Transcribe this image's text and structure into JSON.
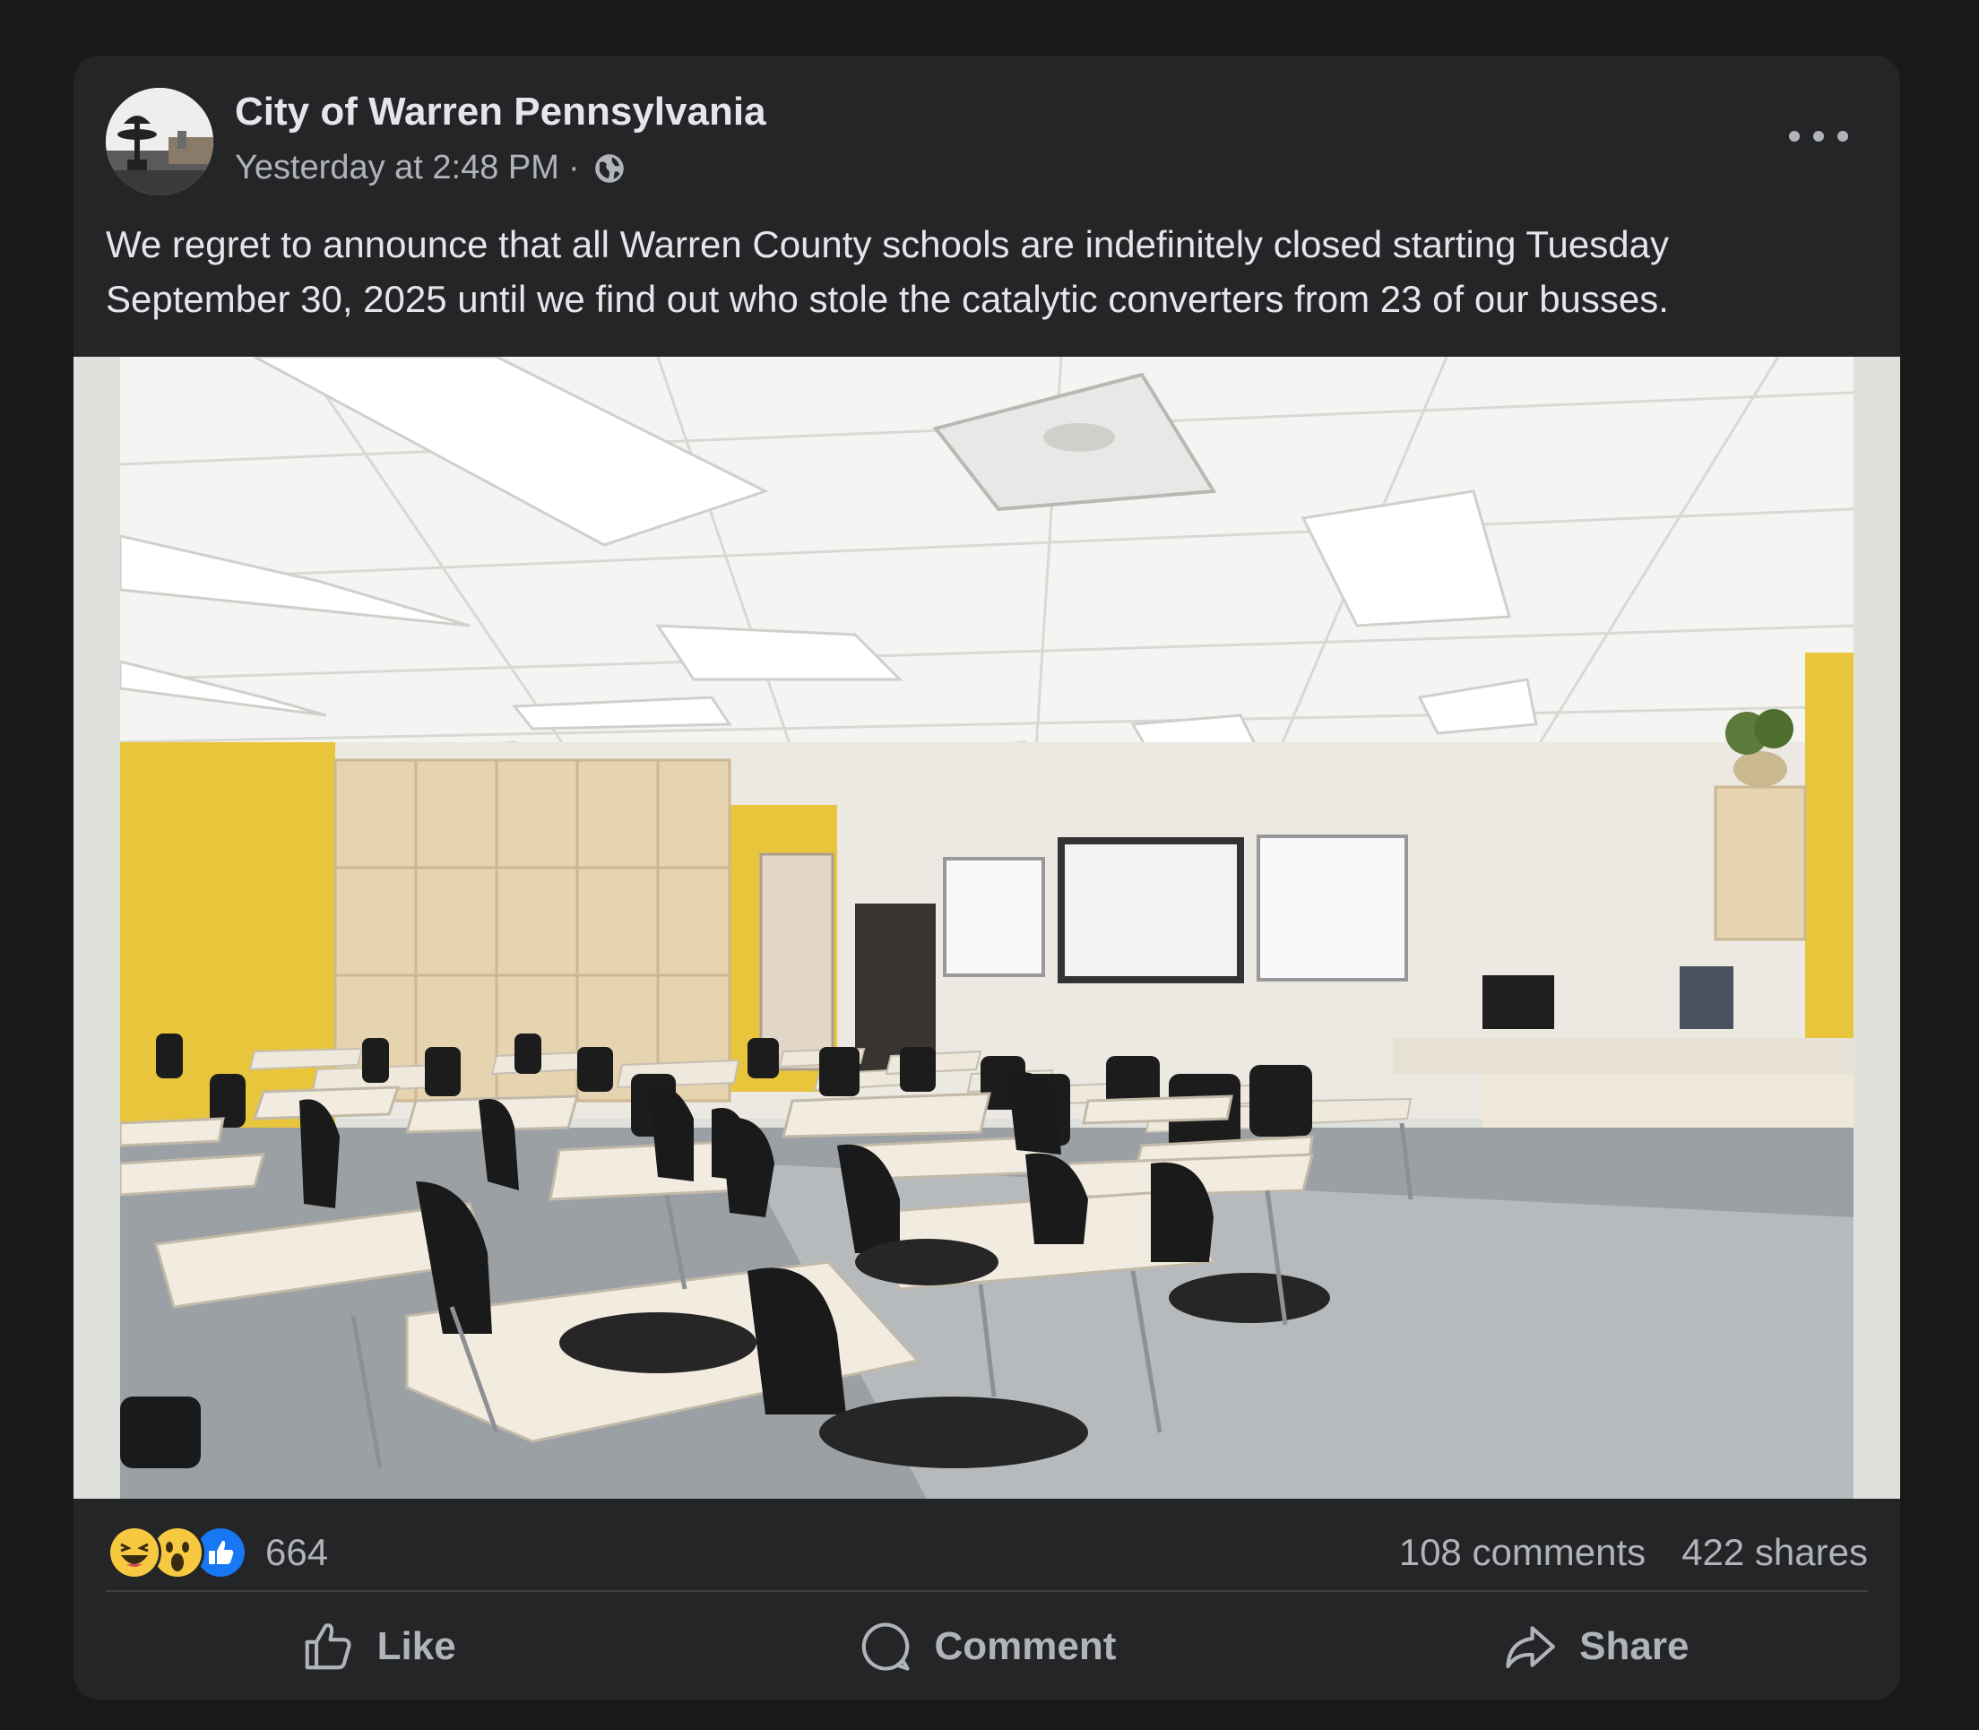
{
  "post": {
    "author": "City of Warren Pennsylvania",
    "timestamp": "Yesterday at 2:48 PM",
    "separator": "·",
    "privacy_icon": "globe-icon",
    "menu_icon": "more-options-icon",
    "text": "We regret to announce that all Warren County schools are indefinitely closed starting Tuesday September 30, 2025 until we find out who stole the catalytic converters from 23 of our busses.",
    "image_subject": "empty classroom with desks"
  },
  "stats": {
    "reaction_icons": [
      "haha-icon",
      "wow-icon",
      "like-icon"
    ],
    "reaction_count": "664",
    "comments": "108 comments",
    "shares": "422 shares"
  },
  "actions": {
    "like": "Like",
    "comment": "Comment",
    "share": "Share"
  },
  "colors": {
    "background": "#18191a",
    "card": "#242526",
    "text_primary": "#e4e6eb",
    "text_secondary": "#b0b3b8",
    "like_blue": "#1877f2",
    "reaction_yellow": "#f7c940"
  }
}
